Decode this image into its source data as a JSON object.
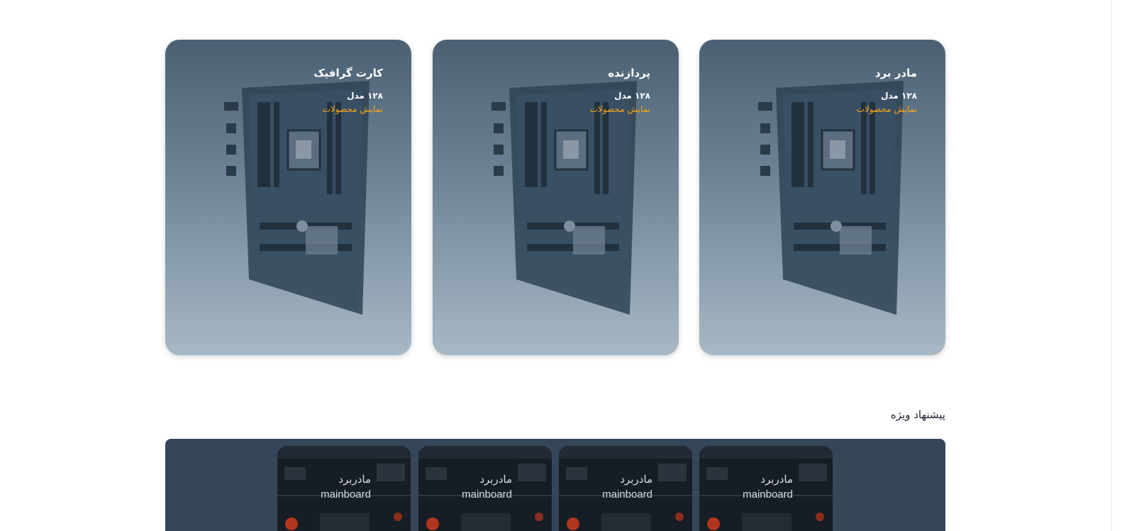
{
  "categories": [
    {
      "title": "مادر برد",
      "count": "۱۲۸ مدل",
      "link": "نمایش محصولات"
    },
    {
      "title": "پردازنده",
      "count": "۱۲۸ مدل",
      "link": "نمایش محصولات"
    },
    {
      "title": "کارت گرافیک",
      "count": "۱۲۸ مدل",
      "link": "نمایش محصولات"
    }
  ],
  "special_offer": {
    "title": "پیشنهاد ویژه",
    "items": [
      {
        "title_fa": "مادربرد",
        "title_en": "mainboard"
      },
      {
        "title_fa": "مادربرد",
        "title_en": "mainboard"
      },
      {
        "title_fa": "مادربرد",
        "title_en": "mainboard"
      },
      {
        "title_fa": "مادربرد",
        "title_en": "mainboard"
      }
    ]
  },
  "colors": {
    "accent_link": "#f9a61a",
    "offer_strip_bg": "#354659",
    "card_gradient_top": "#4b6073",
    "card_gradient_bottom": "#a8b8c5"
  },
  "icons": {
    "category_image": "motherboard-image",
    "offer_image": "circuit-board-image"
  }
}
